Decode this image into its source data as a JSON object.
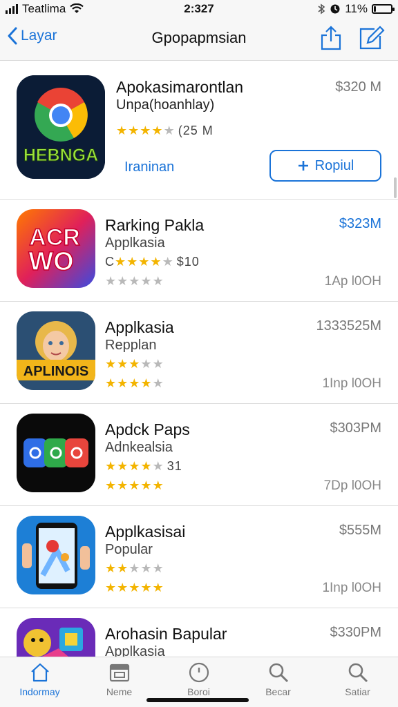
{
  "status_bar": {
    "carrier": "Teatlima",
    "time": "2:327",
    "battery_label": "11%",
    "battery_level": 0.11
  },
  "nav": {
    "back_label": "Layar",
    "title": "Gpopapmsian"
  },
  "featured": {
    "name": "Apokasimarontlan",
    "subtitle": "Unpa(hoanhlay)",
    "price": "$320 M",
    "rating_stars": 4,
    "rating_text": "(25 M",
    "link_label": "Iraninan",
    "button_label": "Ropiul",
    "icon_text": "HEBNGA"
  },
  "apps": [
    {
      "name": "Rarking Pakla",
      "subtitle": "Applkasia",
      "price": "$323M",
      "price_color": "#1a73d8",
      "line1_prefix": "C",
      "line1_stars": 4,
      "line1_text": "$10",
      "line2_stars": 0,
      "size": "1Ap l0OH",
      "icon_text": "ACR WO"
    },
    {
      "name": "Applkasia",
      "subtitle": "Repplan",
      "price": "1333525M",
      "price_color": "#777777",
      "line1_prefix": "",
      "line1_stars": 2.5,
      "line1_text": "",
      "line2_stars": 4,
      "size": "1Inp l0OH",
      "icon_text": "APLINOIS"
    },
    {
      "name": "Apdck Paps",
      "subtitle": "Adnkealsia",
      "price": "$303PM",
      "price_color": "#777777",
      "line1_prefix": "",
      "line1_stars": 3.5,
      "line1_text": "31",
      "line2_stars": 4.5,
      "size": "7Dp l0OH",
      "icon_text": ""
    },
    {
      "name": "Applkasisai",
      "subtitle": "Popular",
      "price": "$555M",
      "price_color": "#777777",
      "line1_prefix": "",
      "line1_stars": 1.5,
      "line1_text": "",
      "line2_stars": 4.5,
      "size": "1Inp l0OH",
      "icon_text": ""
    },
    {
      "name": "Arohasin Bapular",
      "subtitle": "Applkasia",
      "price": "$330PM",
      "price_color": "#777777",
      "line1_prefix": "",
      "line1_stars": 0,
      "line1_text": "",
      "line2_stars": 0,
      "size": "",
      "icon_text": ""
    }
  ],
  "tabs": [
    {
      "label": "Indormay",
      "icon": "home-icon",
      "active": true
    },
    {
      "label": "Neme",
      "icon": "calendar-icon",
      "active": false
    },
    {
      "label": "Boroi",
      "icon": "clock-icon",
      "active": false
    },
    {
      "label": "Becar",
      "icon": "search-icon",
      "active": false
    },
    {
      "label": "Satiar",
      "icon": "search-icon",
      "active": false
    }
  ],
  "colors": {
    "accent": "#1a73d8",
    "star": "#f3b400",
    "star_off": "#b9b9b9"
  }
}
